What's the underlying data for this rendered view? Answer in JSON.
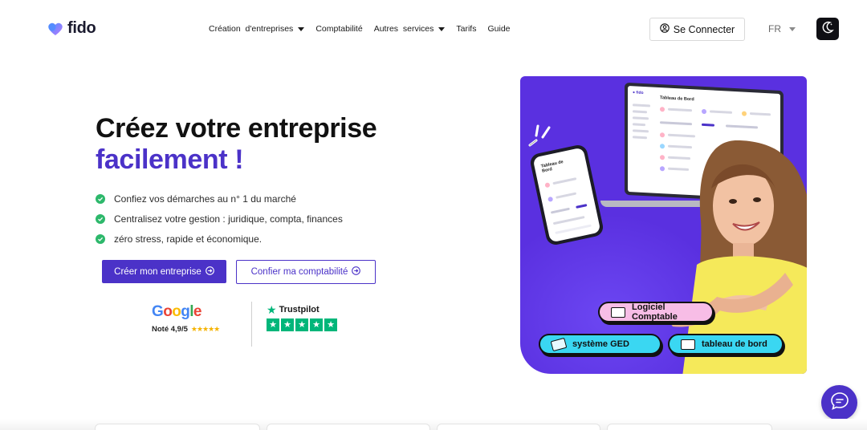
{
  "brand": {
    "name": "fido",
    "accent": "#4b32c8",
    "logo_colors": [
      "#5b8cff",
      "#c77dff"
    ]
  },
  "nav": {
    "items": [
      {
        "label": "Création  d'entreprises",
        "has_dropdown": true
      },
      {
        "label": "Comptabilité",
        "has_dropdown": false
      },
      {
        "label": "Autres  services",
        "has_dropdown": true
      },
      {
        "label": "Tarifs",
        "has_dropdown": false
      },
      {
        "label": "Guide",
        "has_dropdown": false
      }
    ]
  },
  "header": {
    "connect_label": "Se Connecter",
    "language": "FR",
    "theme_icon": "moon-icon"
  },
  "hero": {
    "title_line1": "Créez votre entreprise",
    "title_line2": "facilement !",
    "features": [
      "Confiez vos démarches au n° 1 du marché",
      "Centralisez votre gestion : juridique, compta, finances",
      "zéro stress, rapide et économique."
    ],
    "cta_primary": "Créer mon entreprise",
    "cta_secondary": "Confier ma comptabilité"
  },
  "ratings": {
    "google": {
      "name": "Google",
      "score_text": "Noté 4,9/5",
      "stars": 5
    },
    "trustpilot": {
      "name": "Trustpilot",
      "stars": 5,
      "color": "#00b67a"
    }
  },
  "visual": {
    "background": "#5a30e0",
    "dashboard_title": "Tableau de Bord",
    "phone_title": "Tableau de Bord",
    "badges": [
      {
        "label": "Logiciel Comptable",
        "color": "#f7bde6",
        "icon": "laptop-icon"
      },
      {
        "label": "système GED",
        "color": "#3ad7f2",
        "icon": "document-stack-icon"
      },
      {
        "label": "tableau de bord",
        "color": "#3ad7f2",
        "icon": "dashboard-card-icon"
      }
    ]
  },
  "chat": {
    "icon": "chat-bubble-icon"
  }
}
